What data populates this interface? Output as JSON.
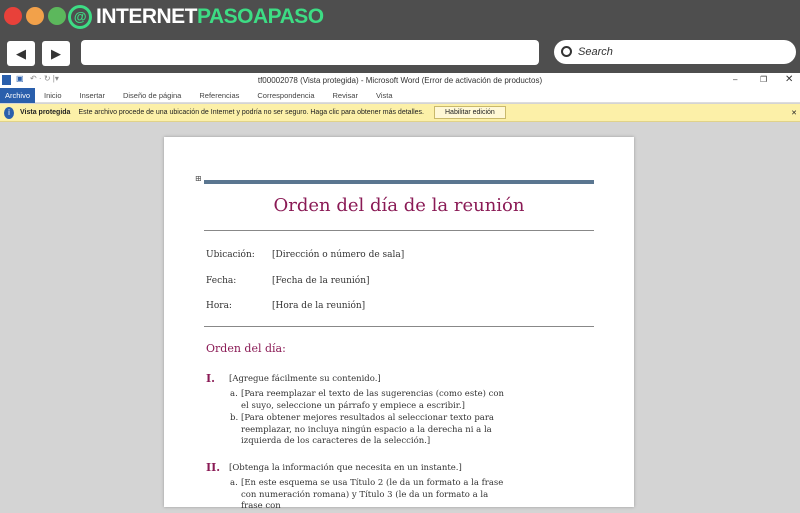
{
  "browser": {
    "logo_a": "INTERNET",
    "logo_b": "PASOAPASO",
    "search_placeholder": "Search",
    "back": "◀",
    "forward": "▶"
  },
  "word": {
    "title": "tf00002078 (Vista protegida) - Microsoft Word (Error de activación de productos)",
    "tabs": [
      "Archivo",
      "Inicio",
      "Insertar",
      "Diseño de página",
      "Referencias",
      "Correspondencia",
      "Revisar",
      "Vista"
    ],
    "info_label": "Vista protegida",
    "info_text": "Este archivo procede de una ubicación de Internet y podría no ser seguro. Haga clic para obtener más detalles.",
    "enable_button": "Habilitar edición"
  },
  "doc": {
    "title": "Orden del día de la reunión",
    "fields": [
      {
        "label": "Ubicación:",
        "value": "[Dirección o número de sala]"
      },
      {
        "label": "Fecha:",
        "value": "[Fecha de la reunión]"
      },
      {
        "label": "Hora:",
        "value": "[Hora de la reunión]"
      }
    ],
    "section": "Orden del día:",
    "items": [
      {
        "num": "I.",
        "text": "[Agregue fácilmente su contenido.]",
        "subs": [
          {
            "l": "a.",
            "t": "[Para reemplazar el texto de las sugerencias (como este) con el suyo, seleccione un párrafo y empiece a escribir.]"
          },
          {
            "l": "b.",
            "t": "[Para obtener mejores resultados al seleccionar texto para reemplazar, no incluya ningún espacio a la derecha ni a la izquierda de los caracteres de la selección.]"
          }
        ]
      },
      {
        "num": "II.",
        "text": "[Obtenga la información que necesita en un instante.]",
        "subs": [
          {
            "l": "a.",
            "t": "[En este esquema se usa Título 2 (le da un formato a la frase con numeración romana) y Título 3 (le da un formato a la frase con"
          }
        ]
      }
    ]
  }
}
